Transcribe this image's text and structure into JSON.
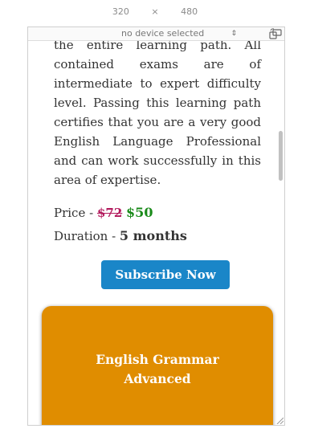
{
  "devtools": {
    "width": "320",
    "times": "×",
    "height": "480",
    "device": "no device selected",
    "device_arrow": "⇕"
  },
  "course": {
    "description": "the entire learning path. All contained exams are of intermediate to expert difficulty level. Passing this learning path certifies that you are a very good English Language Professional and can work successfully in this area of expertise.",
    "price_label": "Price - ",
    "old_price": "$72",
    "new_price": "$50",
    "duration_label": "Duration - ",
    "duration_value": "5 months",
    "subscribe_label": "Subscribe Now"
  },
  "next_card": {
    "title_line1": "English Grammar",
    "title_line2": "Advanced",
    "color": "#e08d00"
  },
  "colors": {
    "accent": "#1a86c8",
    "old_price": "#b2195c",
    "new_price": "#1a8a1a"
  }
}
